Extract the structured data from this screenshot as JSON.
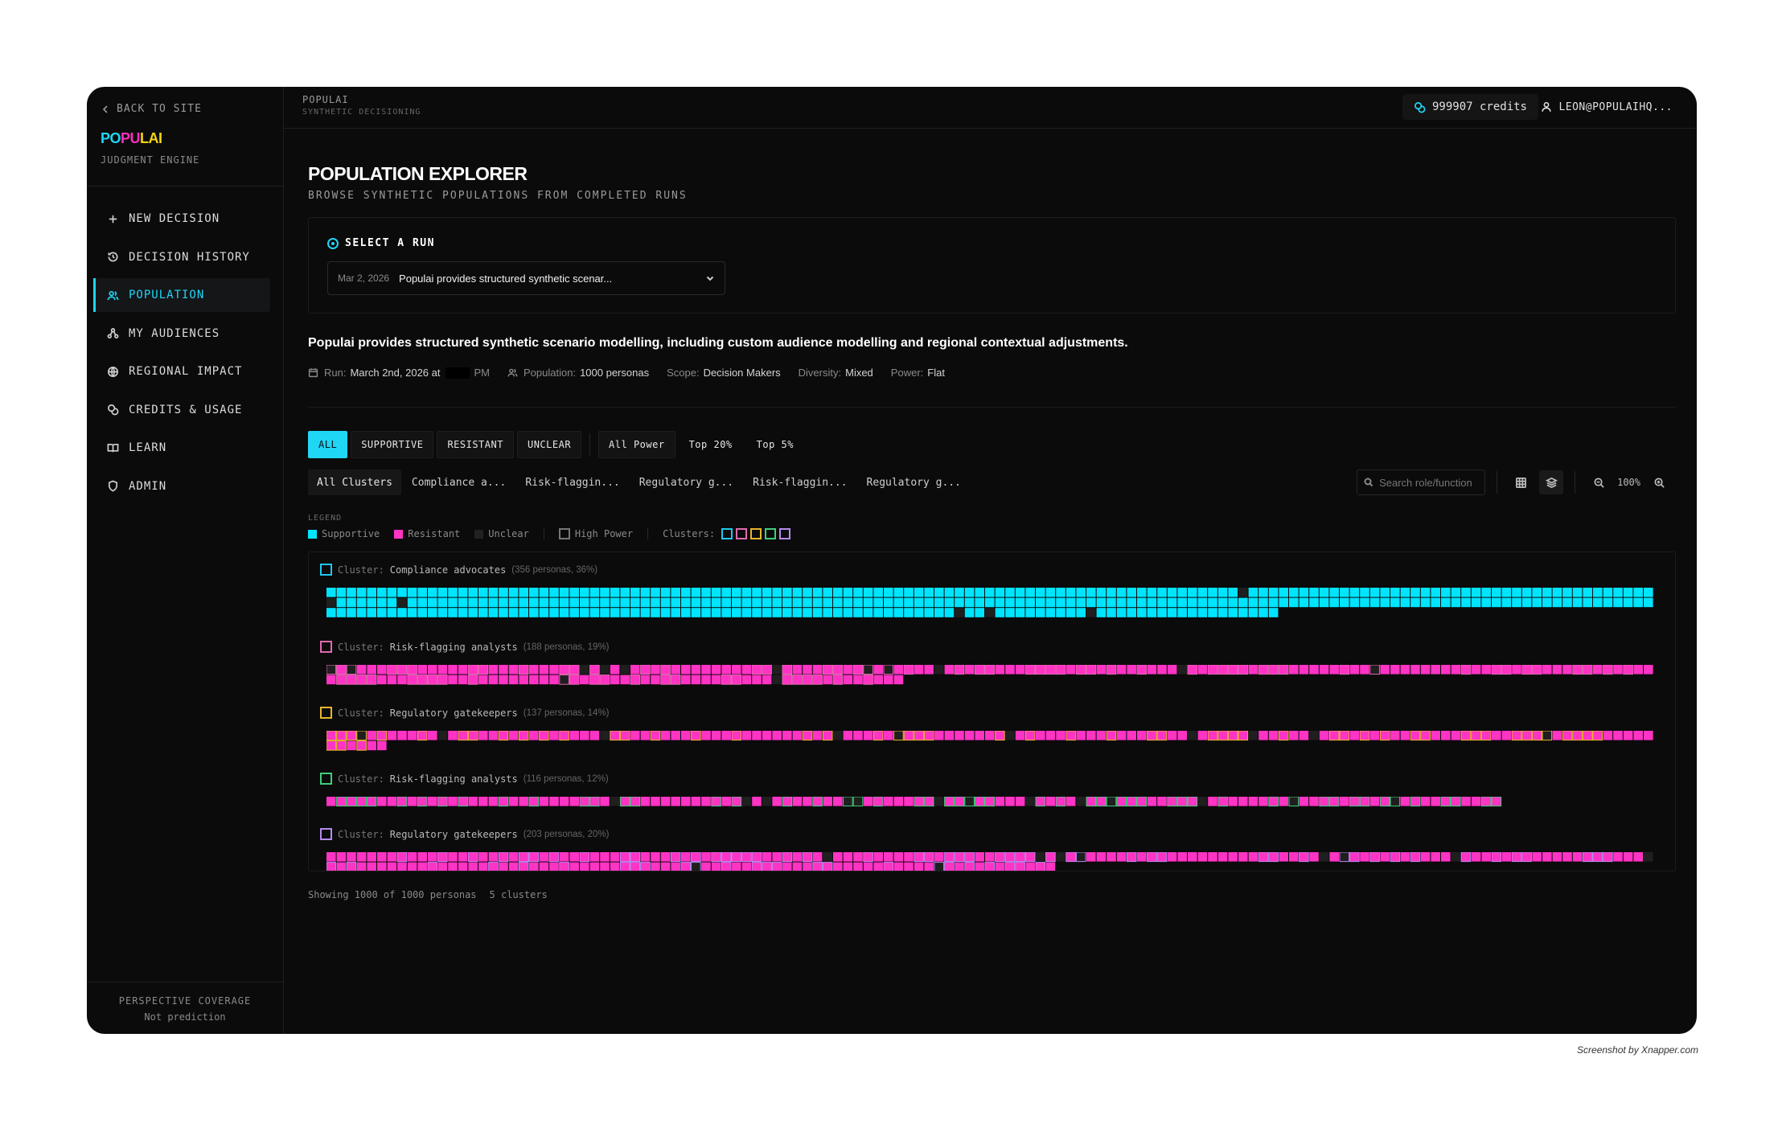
{
  "sidebar": {
    "back": "BACK TO SITE",
    "brand": {
      "p1": "PO",
      "p2": "PU",
      "p3": "LAI"
    },
    "brand_sub": "JUDGMENT ENGINE",
    "items": [
      {
        "label": "NEW DECISION",
        "icon": "plus-icon"
      },
      {
        "label": "DECISION HISTORY",
        "icon": "history-icon"
      },
      {
        "label": "POPULATION",
        "icon": "users-icon",
        "active": true
      },
      {
        "label": "MY AUDIENCES",
        "icon": "audiences-icon"
      },
      {
        "label": "REGIONAL IMPACT",
        "icon": "globe-icon"
      },
      {
        "label": "CREDITS & USAGE",
        "icon": "coins-icon"
      },
      {
        "label": "LEARN",
        "icon": "book-icon"
      },
      {
        "label": "ADMIN",
        "icon": "shield-icon"
      }
    ],
    "footer": {
      "title": "PERSPECTIVE COVERAGE",
      "subtitle": "Not prediction"
    }
  },
  "topbar": {
    "title": "POPULAI",
    "subtitle": "SYNTHETIC DECISIONING",
    "credits": "999907 credits",
    "user": "LEON@POPULAIHQ..."
  },
  "page": {
    "title": "POPULATION EXPLORER",
    "subtitle": "BROWSE SYNTHETIC POPULATIONS FROM COMPLETED RUNS"
  },
  "run": {
    "label": "SELECT A RUN",
    "date": "Mar 2, 2026",
    "name": "Populai provides structured synthetic scenar..."
  },
  "description": "Populai provides structured synthetic scenario modelling, including custom audience modelling and regional contextual adjustments.",
  "meta": {
    "run_label": "Run:",
    "run_value": "March 2nd, 2026 at",
    "run_suffix": "PM",
    "population_label": "Population:",
    "population_value": "1000 personas",
    "scope_label": "Scope:",
    "scope_value": "Decision Makers",
    "diversity_label": "Diversity:",
    "diversity_value": "Mixed",
    "power_label": "Power:",
    "power_value": "Flat"
  },
  "filters": {
    "stance": [
      "ALL",
      "SUPPORTIVE",
      "RESISTANT",
      "UNCLEAR"
    ],
    "power": [
      "All Power",
      "Top 20%",
      "Top 5%"
    ]
  },
  "cluster_tabs": [
    "All Clusters",
    "Compliance a...",
    "Risk-flaggin...",
    "Regulatory g...",
    "Risk-flaggin...",
    "Regulatory g..."
  ],
  "search": {
    "placeholder": "Search role/function"
  },
  "zoom": "100%",
  "legend": {
    "title": "LEGEND",
    "supportive": "Supportive",
    "resistant": "Resistant",
    "unclear": "Unclear",
    "high_power": "High Power",
    "clusters": "Clusters:"
  },
  "colors": {
    "supportive": "#00e5ff",
    "resistant": "#ff33c4",
    "unclear": "#1f1f1f",
    "accent": "#1fd6f5"
  },
  "clusters": [
    {
      "prefix": "Cluster:",
      "name": "Compliance advocates",
      "count": "(356 personas, 36%)",
      "color": "#1fc8ee",
      "personas": 356,
      "stance": "supportive"
    },
    {
      "prefix": "Cluster:",
      "name": "Risk-flagging analysts",
      "count": "(188 personas, 19%)",
      "color": "#e06ab0",
      "personas": 188,
      "stance": "resistant"
    },
    {
      "prefix": "Cluster:",
      "name": "Regulatory gatekeepers",
      "count": "(137 personas, 14%)",
      "color": "#e8b52a",
      "personas": 137,
      "stance": "resistant"
    },
    {
      "prefix": "Cluster:",
      "name": "Risk-flagging analysts",
      "count": "(116 personas, 12%)",
      "color": "#3fcf7a",
      "personas": 116,
      "stance": "resistant"
    },
    {
      "prefix": "Cluster:",
      "name": "Regulatory gatekeepers",
      "count": "(203 personas, 20%)",
      "color": "#b48af0",
      "personas": 203,
      "stance": "resistant"
    }
  ],
  "footer": {
    "showing": "Showing 1000 of 1000 personas",
    "clusters": "5 clusters"
  },
  "screenshot_credit": "Screenshot by Xnapper.com"
}
